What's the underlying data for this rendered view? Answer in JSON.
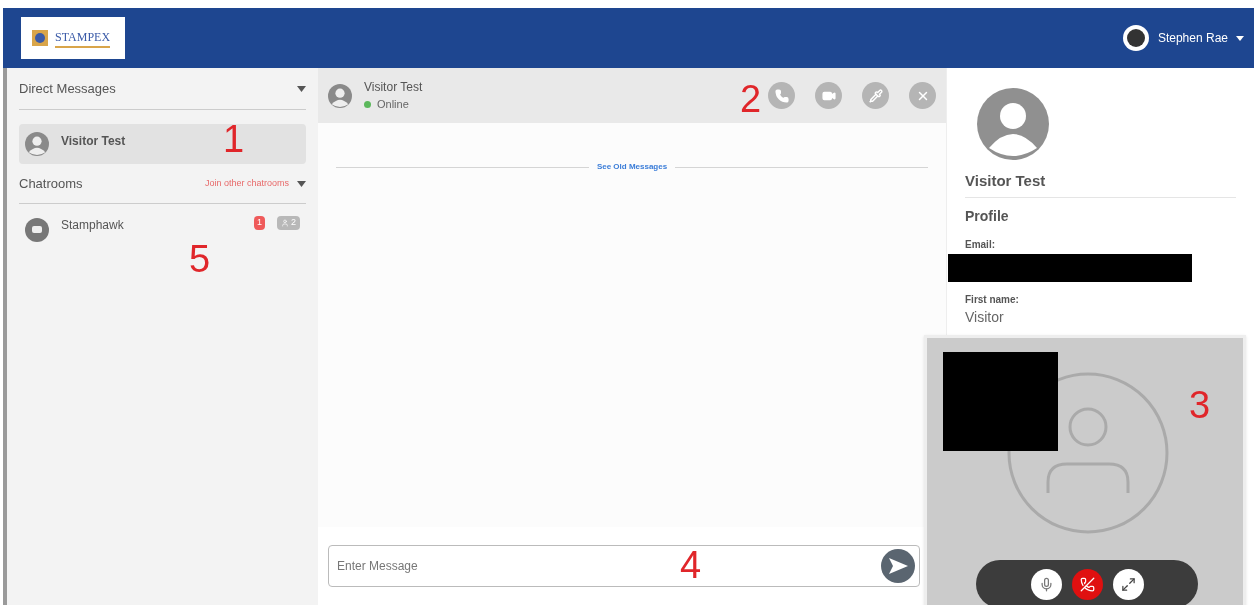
{
  "header": {
    "logo_text": "STAMPEX",
    "user_name": "Stephen Rae"
  },
  "sidebar": {
    "direct_messages": {
      "title": "Direct Messages",
      "items": [
        {
          "name": "Visitor Test",
          "selected": true
        }
      ]
    },
    "chatrooms": {
      "title": "Chatrooms",
      "join_link": "Join other chatrooms",
      "items": [
        {
          "name": "Stamphawk",
          "unread": "1",
          "members": "2",
          "selected": false
        }
      ]
    }
  },
  "chat": {
    "contact": "Visitor Test",
    "status": "Online",
    "online": true,
    "see_old": "See Old Messages",
    "input_placeholder": "Enter Message"
  },
  "profile": {
    "name": "Visitor Test",
    "section": "Profile",
    "fields": [
      {
        "label": "Email:",
        "redacted": true
      },
      {
        "label": "First name:",
        "value": "Visitor",
        "redacted": false
      }
    ]
  },
  "call": {
    "muted": false
  },
  "annotations": [
    "1",
    "2",
    "3",
    "4",
    "5"
  ]
}
